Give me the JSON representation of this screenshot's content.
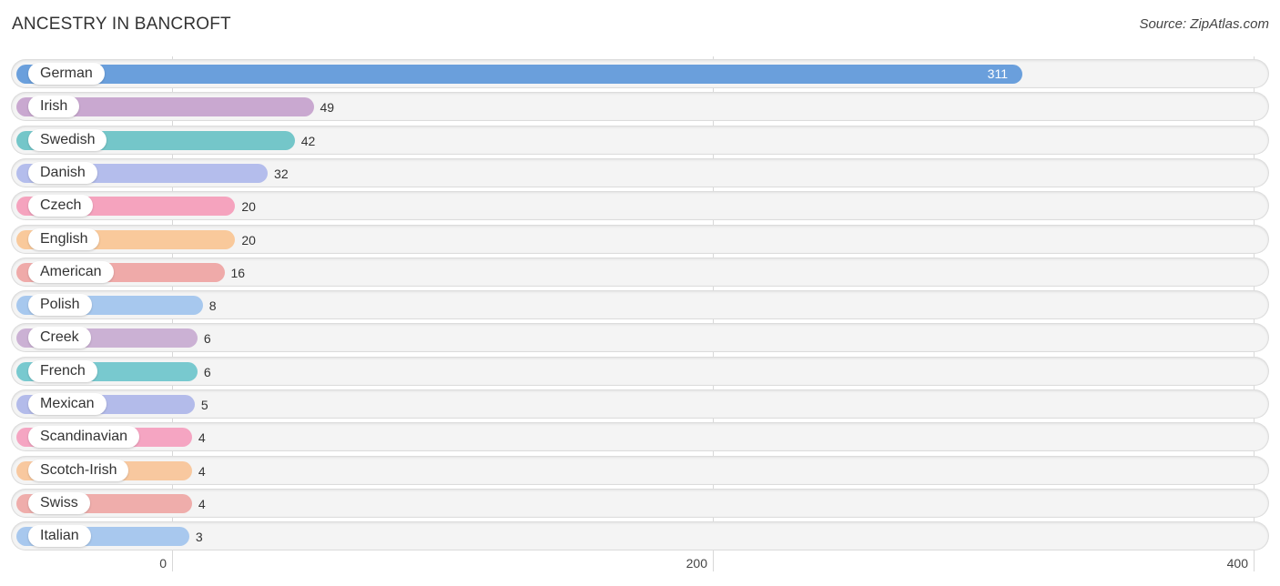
{
  "header": {
    "title": "ANCESTRY IN BANCROFT",
    "source": "Source: ZipAtlas.com"
  },
  "chart_data": {
    "type": "bar",
    "orientation": "horizontal",
    "title": "ANCESTRY IN BANCROFT",
    "xlabel": "",
    "ylabel": "",
    "xlim": [
      0,
      400
    ],
    "x_ticks": [
      "0",
      "200",
      "400"
    ],
    "x_tick_values": [
      0,
      200,
      400
    ],
    "grid": true,
    "categories": [
      "German",
      "Irish",
      "Swedish",
      "Danish",
      "Czech",
      "English",
      "American",
      "Polish",
      "Creek",
      "French",
      "Mexican",
      "Scandinavian",
      "Scotch-Irish",
      "Swiss",
      "Italian"
    ],
    "values": [
      311,
      49,
      42,
      32,
      20,
      20,
      16,
      8,
      6,
      6,
      5,
      4,
      4,
      4,
      3
    ],
    "value_labels": [
      "311",
      "49",
      "42",
      "32",
      "20",
      "20",
      "16",
      "8",
      "6",
      "6",
      "5",
      "4",
      "4",
      "4",
      "3"
    ],
    "colors": [
      "#6a9fdc",
      "#c9a8d0",
      "#74c6c9",
      "#b4bdec",
      "#f5a3be",
      "#f9c99b",
      "#efaaa9",
      "#a7c8ee",
      "#cbb1d4",
      "#78c9cf",
      "#b3bbea",
      "#f5a5c2",
      "#f8c89f",
      "#efadab",
      "#a8c8ee"
    ]
  }
}
